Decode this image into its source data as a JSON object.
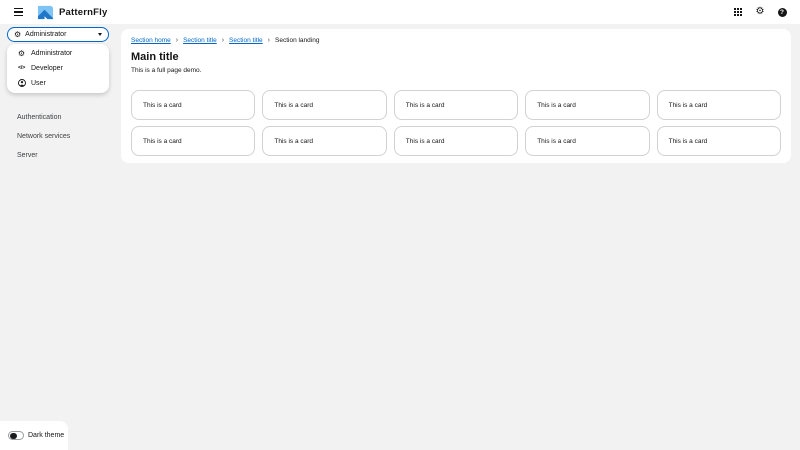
{
  "masthead": {
    "brand": "PatternFly",
    "utility": {
      "apps_tooltip": "applications",
      "settings_tooltip": "settings",
      "help_glyph": "?"
    }
  },
  "icons": {
    "cogs": "⚙",
    "gear": "⚙",
    "code": "</>"
  },
  "sidebar": {
    "context_selector": {
      "selected": "Administrator",
      "options": [
        {
          "label": "Administrator",
          "icon": "cogs-icon"
        },
        {
          "label": "Developer",
          "icon": "code-icon"
        },
        {
          "label": "User",
          "icon": "user-icon"
        }
      ]
    },
    "nav_items": [
      {
        "label": "Authentication"
      },
      {
        "label": "Network services"
      },
      {
        "label": "Server"
      }
    ]
  },
  "breadcrumb": {
    "separator": "›",
    "items": [
      {
        "label": "Section home",
        "link": true
      },
      {
        "label": "Section title",
        "link": true
      },
      {
        "label": "Section title",
        "link": true
      },
      {
        "label": "Section landing",
        "link": false
      }
    ]
  },
  "main": {
    "title": "Main title",
    "subtitle": "This is a full page demo.",
    "cards": [
      "This is a card",
      "This is a card",
      "This is a card",
      "This is a card",
      "This is a card",
      "This is a card",
      "This is a card",
      "This is a card",
      "This is a card",
      "This is a card"
    ]
  },
  "theme_toggle": {
    "label": "Dark theme",
    "state": "off"
  },
  "colors": {
    "accent": "#0066cc",
    "page_bg": "#f2f2f2",
    "panel_bg": "#ffffff",
    "card_border": "#d2d2d2",
    "text": "#151515",
    "logo_light_blue": "#7dc3f3",
    "logo_dark_blue": "#1f77c9"
  }
}
